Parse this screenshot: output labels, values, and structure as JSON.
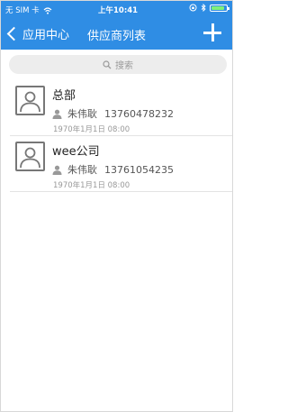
{
  "status_bar": {
    "carrier": "无 SIM 卡",
    "time": "上午10:41",
    "battery_fill": 0.85
  },
  "nav": {
    "back_label": "应用中心",
    "title": "供应商列表",
    "colors": {
      "accent": "#2f8de4"
    }
  },
  "search": {
    "placeholder": "搜索"
  },
  "suppliers": [
    {
      "name": "总部",
      "contact": "朱伟耿",
      "phone": "13760478232",
      "date": "1970年1月1日 08:00"
    },
    {
      "name": "wee公司",
      "contact": "朱伟耿",
      "phone": "13761054235",
      "date": "1970年1月1日 08:00"
    }
  ]
}
